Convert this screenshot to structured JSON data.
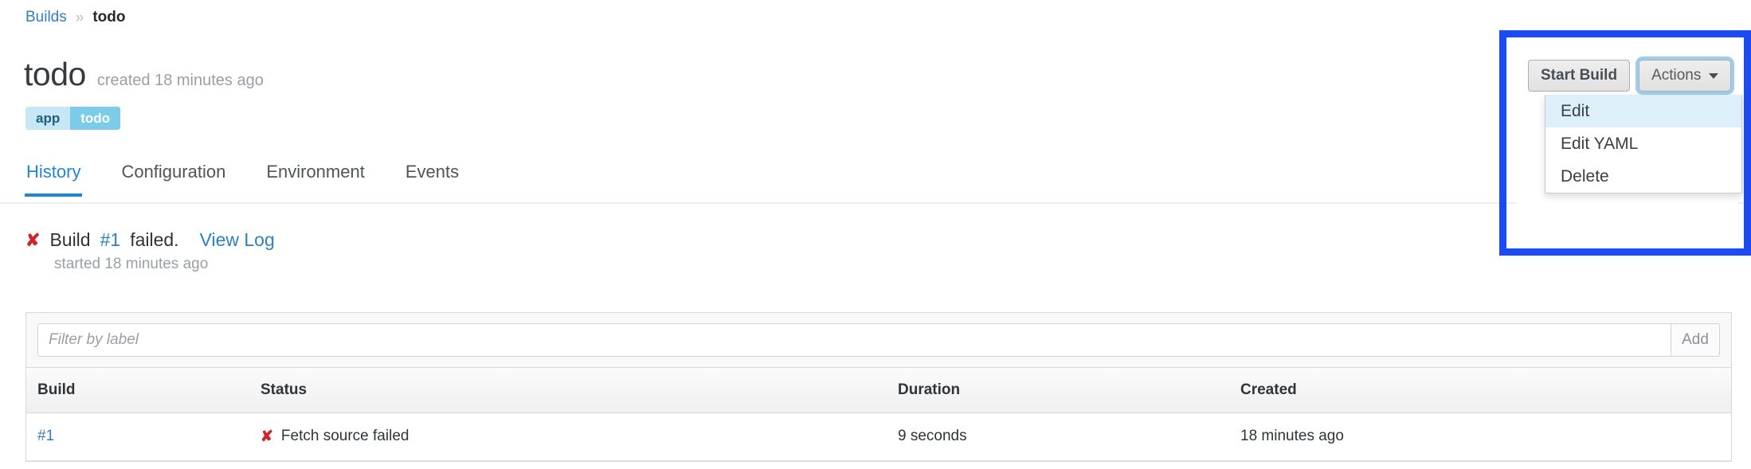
{
  "breadcrumb": {
    "root_label": "Builds",
    "separator": "»",
    "current_label": "todo"
  },
  "header": {
    "title": "todo",
    "created_text": "created 18 minutes ago",
    "label_key": "app",
    "label_value": "todo"
  },
  "tabs": [
    {
      "label": "History",
      "active": true
    },
    {
      "label": "Configuration",
      "active": false
    },
    {
      "label": "Environment",
      "active": false
    },
    {
      "label": "Events",
      "active": false
    }
  ],
  "build_status": {
    "icon": "x-mark-icon",
    "prefix": "Build",
    "build_number": "#1",
    "suffix": "failed.",
    "view_log_label": "View Log",
    "started_text": "started 18 minutes ago",
    "error_color": "#d1232a",
    "link_color": "#2e7fc1"
  },
  "filter": {
    "placeholder": "Filter by label",
    "value": "",
    "add_label": "Add"
  },
  "builds_table": {
    "columns": [
      "Build",
      "Status",
      "Duration",
      "Created"
    ],
    "rows": [
      {
        "build": "#1",
        "status_icon": "x-mark-icon",
        "status": "Fetch source failed",
        "duration": "9 seconds",
        "created": "18 minutes ago"
      }
    ]
  },
  "actions_panel": {
    "start_build_label": "Start Build",
    "actions_label": "Actions",
    "caret_icon": "chevron-down-icon",
    "highlight_color": "#1a4bf5",
    "menu_items": [
      {
        "label": "Edit",
        "active": true
      },
      {
        "label": "Edit YAML",
        "active": false
      },
      {
        "label": "Delete",
        "active": false
      }
    ]
  }
}
